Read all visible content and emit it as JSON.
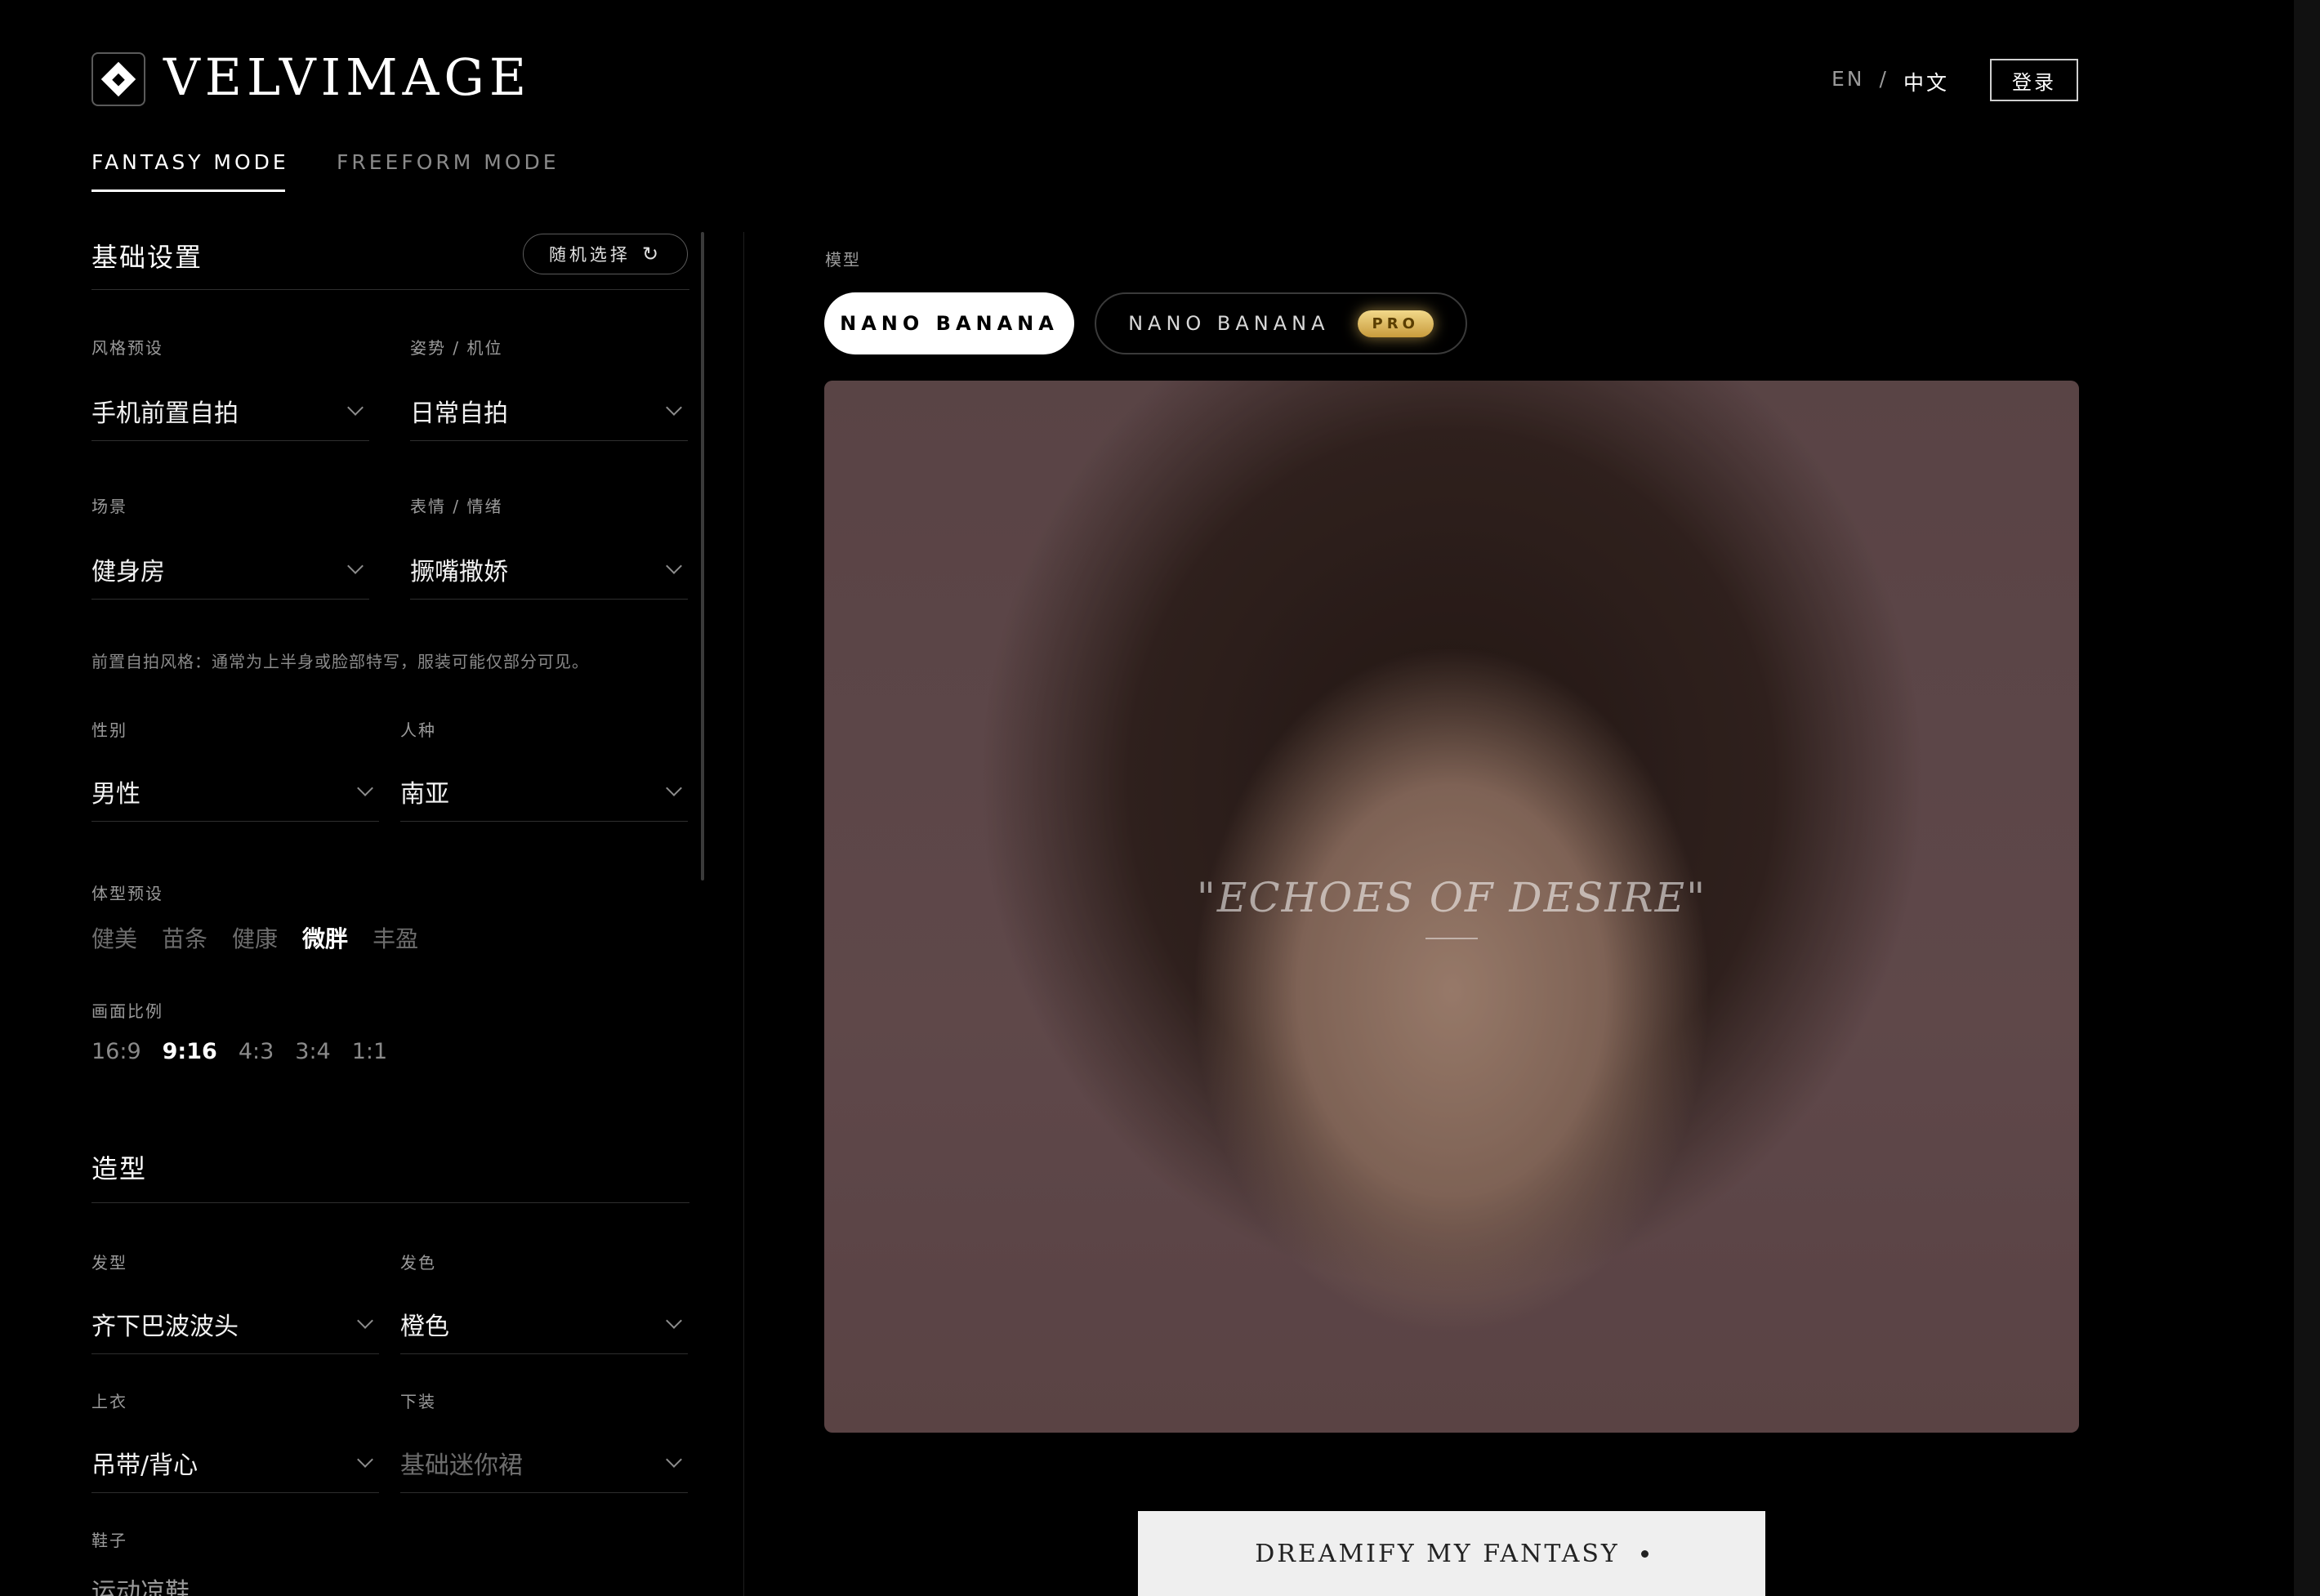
{
  "header": {
    "brand": "VELVIMAGE",
    "lang_en": "EN",
    "lang_sep": "/",
    "lang_zh": "中文",
    "login": "登录"
  },
  "tabs": [
    {
      "label": "FANTASY MODE",
      "active": true
    },
    {
      "label": "FREEFORM MODE",
      "active": false
    }
  ],
  "basic": {
    "title": "基础设置",
    "random_button": "随机选择",
    "style_label": "风格预设",
    "style_value": "手机前置自拍",
    "pose_label": "姿势 / 机位",
    "pose_value": "日常自拍",
    "scene_label": "场景",
    "scene_value": "健身房",
    "mood_label": "表情 / 情绪",
    "mood_value": "撅嘴撒娇",
    "hint": "前置自拍风格：通常为上半身或脸部特写，服装可能仅部分可见。",
    "gender_label": "性别",
    "gender_value": "男性",
    "ethnicity_label": "人种",
    "ethnicity_value": "南亚",
    "body_label": "体型预设",
    "body_options": [
      "健美",
      "苗条",
      "健康",
      "微胖",
      "丰盈"
    ],
    "body_selected": "微胖",
    "ratio_label": "画面比例",
    "ratio_options": [
      "16:9",
      "9:16",
      "4:3",
      "3:4",
      "1:1"
    ],
    "ratio_selected": "9:16"
  },
  "styling": {
    "title": "造型",
    "hair_label": "发型",
    "hair_value": "齐下巴波波头",
    "haircolor_label": "发色",
    "haircolor_value": "橙色",
    "top_label": "上衣",
    "top_value": "吊带/背心",
    "bottom_label": "下装",
    "bottom_value": "基础迷你裙",
    "shoes_label": "鞋子",
    "shoes_value": "运动凉鞋"
  },
  "model": {
    "label": "模型",
    "option1": "NANO BANANA",
    "option2": "NANO BANANA",
    "pro_badge": "PRO",
    "selected": "NANO BANANA"
  },
  "preview": {
    "caption": "\"ECHOES OF DESIRE\""
  },
  "cta": {
    "label": "DREAMIFY MY FANTASY"
  }
}
